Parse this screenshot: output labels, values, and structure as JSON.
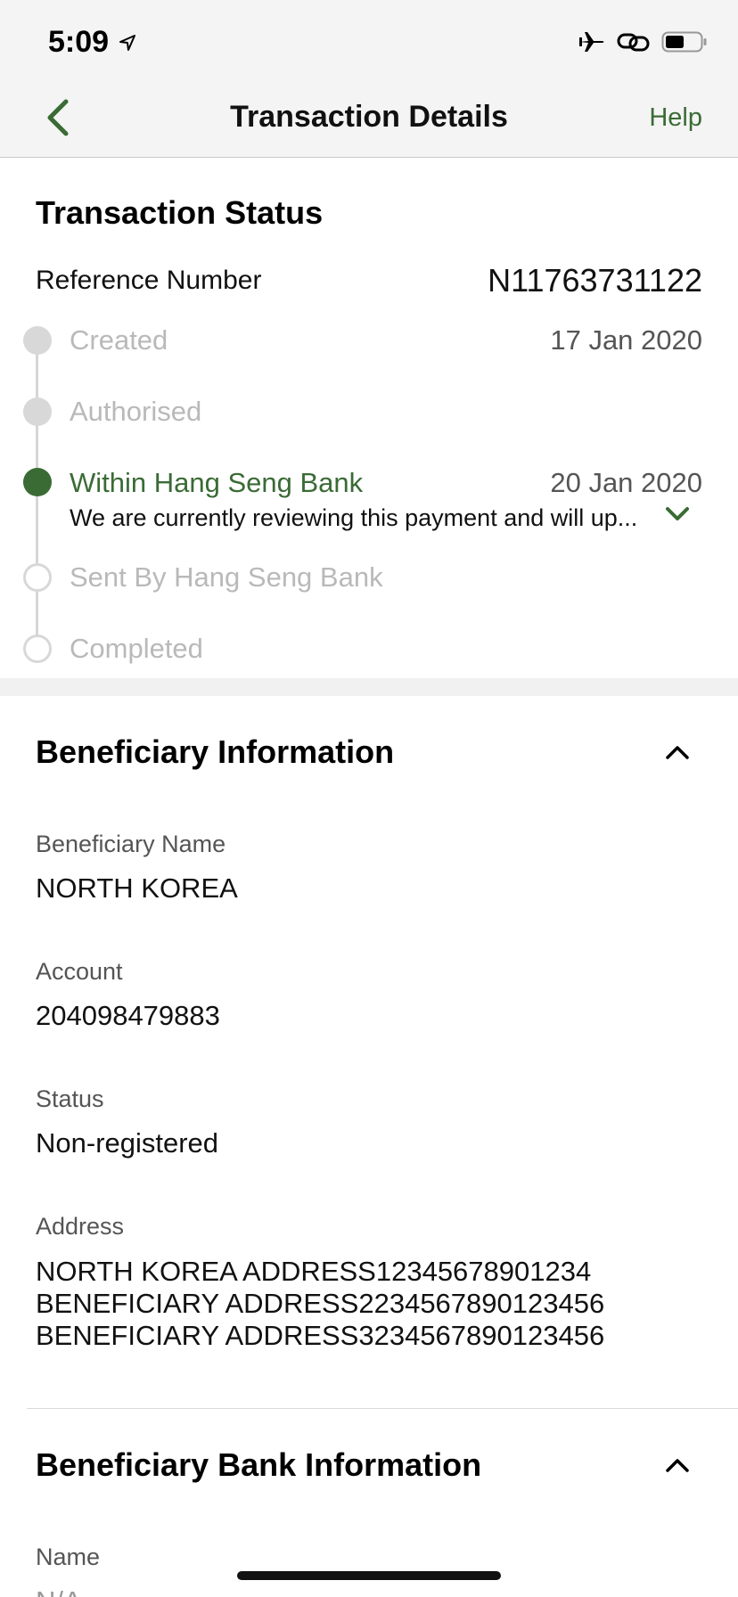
{
  "status_bar": {
    "time": "5:09",
    "icons": [
      "location-arrow-icon",
      "airplane-icon",
      "link-icon",
      "battery-icon"
    ]
  },
  "nav": {
    "title": "Transaction Details",
    "help_label": "Help",
    "back_icon": "chevron-left-icon"
  },
  "colors": {
    "accent": "#3a6b35",
    "inactive": "#b9b9b9"
  },
  "transaction_status": {
    "title": "Transaction Status",
    "reference_label": "Reference Number",
    "reference_value": "N11763731122",
    "steps": [
      {
        "label": "Created",
        "date": "17 Jan 2020",
        "state": "done"
      },
      {
        "label": "Authorised",
        "date": "",
        "state": "done"
      },
      {
        "label": "Within Hang Seng Bank",
        "date": "20 Jan 2020",
        "state": "active",
        "note": "We are currently reviewing this payment and will up..."
      },
      {
        "label": "Sent By Hang Seng Bank",
        "date": "",
        "state": "pending"
      },
      {
        "label": "Completed",
        "date": "",
        "state": "pending"
      }
    ]
  },
  "beneficiary": {
    "title": "Beneficiary Information",
    "fields": [
      {
        "label": "Beneficiary Name",
        "value": "NORTH KOREA"
      },
      {
        "label": "Account",
        "value": "204098479883"
      },
      {
        "label": "Status",
        "value": "Non-registered"
      },
      {
        "label": "Address",
        "lines": [
          "NORTH KOREA ADDRESS12345678901234",
          "BENEFICIARY ADDRESS2234567890123456",
          "BENEFICIARY ADDRESS3234567890123456"
        ]
      }
    ]
  },
  "beneficiary_bank": {
    "title": "Beneficiary Bank Information",
    "fields": [
      {
        "label": "Name",
        "value": "N/A"
      }
    ]
  }
}
